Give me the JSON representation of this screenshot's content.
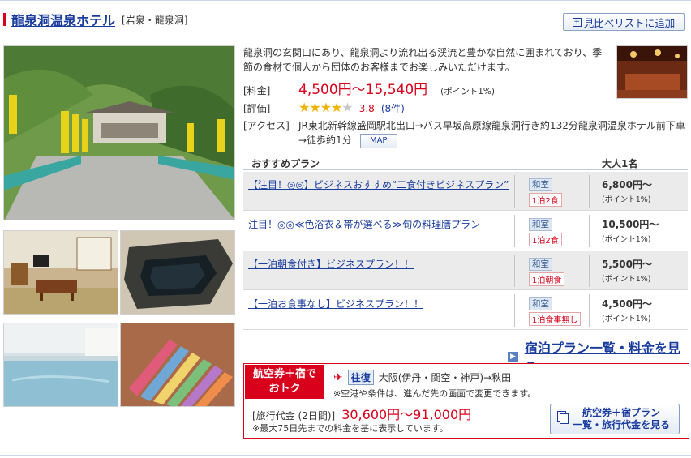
{
  "header": {
    "hotel_name": "龍泉洞温泉ホテル",
    "area": "[岩泉・龍泉洞]",
    "compare_button": "見比べリストに追加",
    "compare_icon": "plus-box-icon"
  },
  "description": "龍泉洞の玄関口にあり、龍泉洞より流れ出る渓流と豊かな自然に囲まれており、季節の食材で個人から団体のお客様までお楽しみいただけます。",
  "price_info": {
    "label": "[料金]",
    "range": "4,500円〜15,540円",
    "points": "(ポイント1%)"
  },
  "rating": {
    "label": "[評価]",
    "stars_filled": "★★★★",
    "stars_empty": "★",
    "value": 3.8,
    "value_text": "3.8",
    "reviews_link": "(8件)"
  },
  "access": {
    "label": "[アクセス]",
    "text": "JR東北新幹線盛岡駅北出口→バス早坂高原線龍泉洞行き約132分龍泉洞温泉ホテル前下車→徒歩約1分",
    "map_button": "MAP"
  },
  "plans": {
    "header_plan": "おすすめプラン",
    "header_price": "大人1名",
    "rows": [
      {
        "title": "【注目！◎◎】ビジネスおすすめ“二食付きビジネスプラン”",
        "room": "和室",
        "meal": "1泊2食",
        "price": "6,800円〜",
        "points": "(ポイント1%)"
      },
      {
        "title": "注目！◎◎≪色浴衣＆帯が選べる≫旬の料理膳プラン",
        "room": "和室",
        "meal": "1泊2食",
        "price": "10,500円〜",
        "points": "(ポイント1%)"
      },
      {
        "title": "【一泊朝食付き】ビジネスプラン！！",
        "room": "和室",
        "meal": "1泊朝食",
        "price": "5,500円〜",
        "points": "(ポイント1%)"
      },
      {
        "title": "【一泊お食事なし】ビジネスプラン！！",
        "room": "和室",
        "meal": "1泊食事無し",
        "price": "4,500円〜",
        "points": "(ポイント1%)"
      }
    ],
    "all_plans_link": "宿泊プラン一覧・料金を見る"
  },
  "air_hotel": {
    "badge_line1": "航空券＋宿で",
    "badge_line2": "おトク",
    "plane_icon": "airplane-icon",
    "roundtrip": "往復",
    "route": "大阪(伊丹・関空・神戸)→秋田",
    "note1": "※空港や条件は、進んだ先の画面で変更できます。",
    "travel_label": "[旅行代金 (2日間)]",
    "travel_price": "30,600円〜91,000円",
    "note2": "※最大75日先までの料金を基に表示しています。",
    "button_line1": "航空券＋宿プラン",
    "button_line2": "一覧・旅行代金を見る"
  },
  "colors": {
    "link": "#1a3c9e",
    "price_red": "#d8001a",
    "star": "#f0b400"
  }
}
